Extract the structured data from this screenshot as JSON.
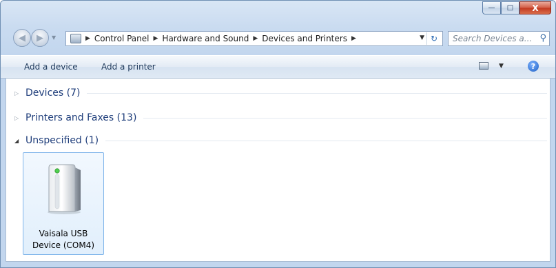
{
  "window": {
    "caption_buttons": {
      "minimize": "—",
      "maximize": "□",
      "close": "X"
    }
  },
  "navigation": {
    "back_icon": "back-arrow-icon",
    "forward_icon": "forward-arrow-icon",
    "breadcrumbs": [
      "Control Panel",
      "Hardware and Sound",
      "Devices and Printers"
    ],
    "search_placeholder": "Search Devices a..."
  },
  "commandbar": {
    "add_device": "Add a device",
    "add_printer": "Add a printer"
  },
  "groups": [
    {
      "label": "Devices (7)",
      "expanded": false
    },
    {
      "label": "Printers and Faxes (13)",
      "expanded": false
    },
    {
      "label": "Unspecified (1)",
      "expanded": true
    }
  ],
  "devices": [
    {
      "label_line1": "Vaisala USB",
      "label_line2": "Device (COM4)",
      "icon": "usb-device-tower-icon"
    }
  ]
}
